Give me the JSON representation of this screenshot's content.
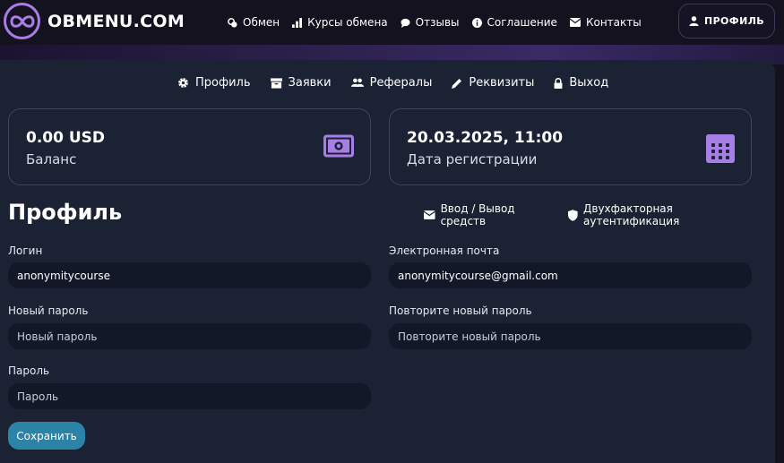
{
  "brand": {
    "name": "OBMENU.COM"
  },
  "topnav": [
    {
      "label": "Обмен",
      "icon": "exchange-coins-icon"
    },
    {
      "label": "Курсы обмена",
      "icon": "bar-chart-icon"
    },
    {
      "label": "Отзывы",
      "icon": "chat-bubble-icon"
    },
    {
      "label": "Соглашение",
      "icon": "info-circle-icon"
    },
    {
      "label": "Контакты",
      "icon": "envelope-icon"
    }
  ],
  "profile_button": {
    "label": "ПРОФИЛЬ",
    "icon": "user-icon"
  },
  "subnav": [
    {
      "label": "Профиль",
      "icon": "gear-icon"
    },
    {
      "label": "Заявки",
      "icon": "archive-box-icon"
    },
    {
      "label": "Рефералы",
      "icon": "users-icon"
    },
    {
      "label": "Реквизиты",
      "icon": "pencil-icon"
    },
    {
      "label": "Выход",
      "icon": "lock-icon"
    }
  ],
  "stats": {
    "balance": {
      "value": "0.00 USD",
      "label": "Баланс",
      "icon": "money-bill-icon"
    },
    "registration": {
      "value": "20.03.2025, 11:00",
      "label": "Дата регистрации",
      "icon": "calendar-icon"
    }
  },
  "page": {
    "title": "Профиль"
  },
  "actions": [
    {
      "label": "Ввод / Вывод средств",
      "icon": "envelope-icon"
    },
    {
      "label": "Двухфакторная аутентификация",
      "icon": "shield-icon"
    }
  ],
  "form": {
    "login": {
      "label": "Логин",
      "value": "anonymitycourse"
    },
    "email": {
      "label": "Электронная почта",
      "value": "anonymitycourse@gmail.com"
    },
    "new_password": {
      "label": "Новый пароль",
      "placeholder": "Новый пароль"
    },
    "repeat_password": {
      "label": "Повторите новый пароль",
      "placeholder": "Повторите новый пароль"
    },
    "password": {
      "label": "Пароль",
      "placeholder": "Пароль"
    },
    "save_label": "Сохранить"
  },
  "colors": {
    "accent_purple": "#a77ee6",
    "save_button": "#2b83a7",
    "card_bg": "#1b2234",
    "input_bg": "#121827",
    "page_bg": "#14121f"
  }
}
